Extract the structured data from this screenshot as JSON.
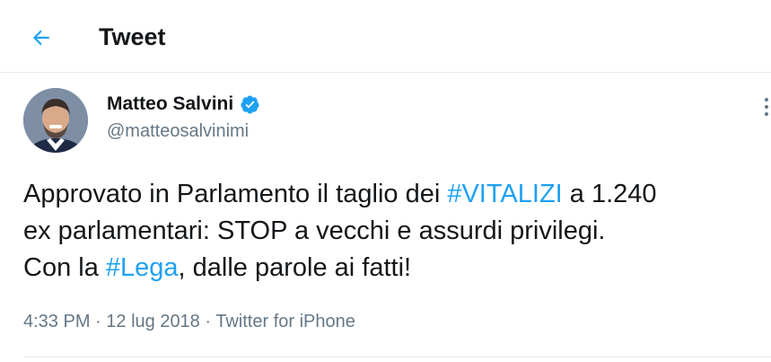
{
  "header": {
    "back_icon": "arrow-left-icon",
    "title": "Tweet"
  },
  "tweet": {
    "author": {
      "name": "Matteo Salvini",
      "handle": "@matteosalvinimi",
      "verified": true,
      "verified_icon": "verified-badge-icon"
    },
    "text": {
      "line1_prefix": "Approvato in Parlamento il taglio dei ",
      "hashtag1": "#VITALIZI",
      "line1_suffix": " a 1.240",
      "line2": "ex parlamentari: STOP a vecchi e assurdi privilegi.",
      "line3_prefix": "Con la ",
      "hashtag2": "#Lega",
      "line3_suffix": ", dalle parole ai fatti!"
    },
    "meta": {
      "time": "4:33 PM",
      "separator1": " · ",
      "date": "12 lug 2018",
      "separator2": " · ",
      "source": "Twitter for iPhone"
    },
    "more_icon": "more-options-icon"
  },
  "colors": {
    "accent": "#1da1f2",
    "text_primary": "#14171a",
    "text_secondary": "#657786",
    "border": "#e6ecf0"
  }
}
